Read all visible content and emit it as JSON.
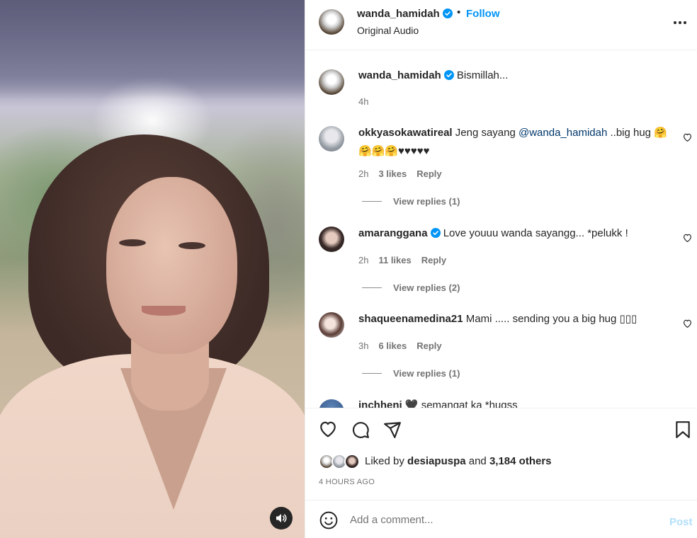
{
  "post": {
    "author": "wanda_hamidah",
    "follow_label": "Follow",
    "dot": "•",
    "audio": "Original Audio",
    "caption": "Bismillah...",
    "caption_time": "4h"
  },
  "comments": [
    {
      "user": "okkyasokawatireal",
      "text_before": "Jeng sayang ",
      "mention": "@wanda_hamidah",
      "text_after": " ..big hug 🤗🤗🤗🤗♥♥♥♥♥",
      "time": "2h",
      "likes": "3 likes",
      "reply": "Reply",
      "view_replies": "View replies (1)"
    },
    {
      "user": "amaranggana",
      "verified": true,
      "text": "Love youuu wanda sayangg... *pelukk !",
      "time": "2h",
      "likes": "11 likes",
      "reply": "Reply",
      "view_replies": "View replies (2)"
    },
    {
      "user": "shaqueenamedina21",
      "text": "Mami ..... sending you a big hug ▯▯▯",
      "time": "3h",
      "likes": "6 likes",
      "reply": "Reply",
      "view_replies": "View replies (1)"
    },
    {
      "user": "inchheni",
      "text": "🖤 semangat ka *hugss"
    }
  ],
  "likes": {
    "liked_by_prefix": "Liked by ",
    "liked_by_user": "desiapuspa",
    "and": " and ",
    "others": "3,184 others"
  },
  "timestamp": "4 HOURS AGO",
  "add_comment": {
    "placeholder": "Add a comment...",
    "post_label": "Post"
  },
  "colors": {
    "link_blue": "#0095f6",
    "mention_blue": "#00376b",
    "verified_blue": "#0095f6",
    "muted": "#737373"
  },
  "icons": [
    "more-options-icon",
    "heart-icon",
    "comment-icon",
    "share-icon",
    "save-icon",
    "emoji-icon",
    "audio-icon",
    "verified-badge-icon"
  ]
}
